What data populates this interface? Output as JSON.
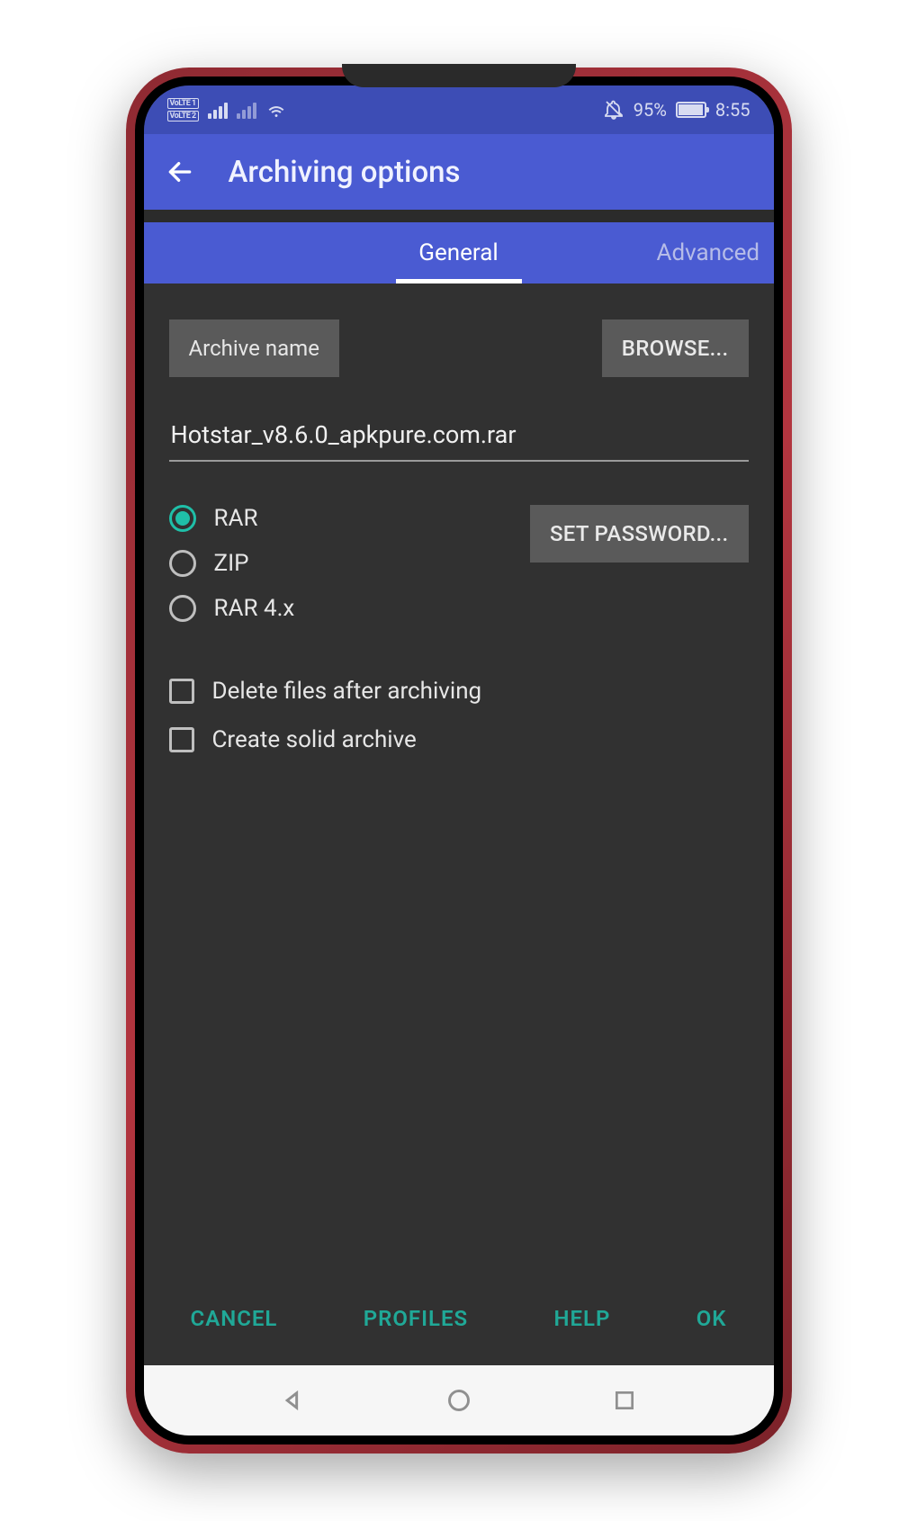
{
  "status": {
    "volte1": "VoLTE 1",
    "volte2": "VoLTE 2",
    "battery_pct": "95%",
    "time": "8:55"
  },
  "appbar": {
    "title": "Archiving options"
  },
  "tabs": {
    "general": "General",
    "advanced": "Advanced"
  },
  "general": {
    "archive_name_label": "Archive name",
    "browse_label": "BROWSE...",
    "archive_name_value": "Hotstar_v8.6.0_apkpure.com.rar",
    "set_password_label": "SET PASSWORD...",
    "formats": {
      "rar": "RAR",
      "zip": "ZIP",
      "rar4": "RAR 4.x",
      "selected": "rar"
    },
    "checkboxes": {
      "delete_after": "Delete files after archiving",
      "solid_archive": "Create solid archive"
    }
  },
  "footer": {
    "cancel": "CANCEL",
    "profiles": "PROFILES",
    "help": "HELP",
    "ok": "OK"
  }
}
